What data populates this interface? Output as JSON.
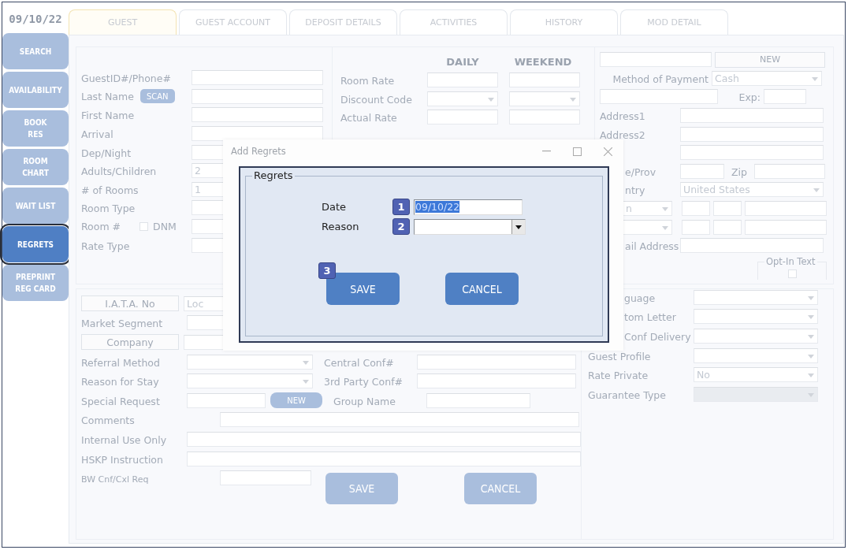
{
  "date": "09/10/22",
  "sidebar": [
    {
      "label": "SEARCH",
      "selected": false
    },
    {
      "label": "AVAILABILITY",
      "selected": false
    },
    {
      "label": "BOOK\nRES",
      "selected": false
    },
    {
      "label": "ROOM\nCHART",
      "selected": false
    },
    {
      "label": "WAIT LIST",
      "selected": false
    },
    {
      "label": "REGRETS",
      "selected": true
    },
    {
      "label": "PREPRINT\nREG CARD",
      "selected": false
    }
  ],
  "tabs": [
    {
      "label": "GUEST",
      "selected": true
    },
    {
      "label": "GUEST ACCOUNT",
      "selected": false
    },
    {
      "label": "DEPOSIT DETAILS",
      "selected": false
    },
    {
      "label": "ACTIVITIES",
      "selected": false
    },
    {
      "label": "HISTORY",
      "selected": false
    },
    {
      "label": "MOD DETAIL",
      "selected": false
    }
  ],
  "guest": {
    "rows": [
      {
        "kind": "text",
        "label": "GuestID#/Phone#"
      },
      {
        "kind": "scan",
        "label": "Last Name",
        "button": "SCAN"
      },
      {
        "kind": "text",
        "label": "First Name"
      },
      {
        "kind": "text",
        "label": "Arrival"
      },
      {
        "kind": "text",
        "label": "Dep/Night"
      },
      {
        "kind": "text",
        "label": "Adults/Children",
        "value": "2"
      },
      {
        "kind": "text",
        "label": "# of Rooms",
        "value": "1"
      },
      {
        "kind": "text",
        "label": "Room Type"
      },
      {
        "kind": "check",
        "label": "Room #",
        "check_label": "DNM",
        "checked": false
      },
      {
        "kind": "text",
        "label": "Rate Type"
      }
    ]
  },
  "rates": {
    "headers": [
      "DAILY",
      "WEEKEND"
    ],
    "rows": [
      {
        "kind": "text",
        "label": "Room Rate"
      },
      {
        "kind": "select",
        "label": "Discount Code"
      },
      {
        "kind": "text",
        "label": "Actual Rate"
      }
    ]
  },
  "payment": {
    "rows": [
      {
        "kind": "new",
        "button": "NEW"
      },
      {
        "kind": "payment",
        "label": "Method of Payment",
        "value": "Cash"
      },
      {
        "kind": "exp",
        "label": "Exp:"
      },
      {
        "kind": "text",
        "label": "Address1"
      },
      {
        "kind": "text",
        "label": "Address2"
      },
      {
        "kind": "text"
      },
      {
        "kind": "zip",
        "label": "e/Prov",
        "label2": "Zip"
      },
      {
        "kind": "select",
        "label": "ntry",
        "value": "United States"
      },
      {
        "kind": "phone",
        "value": "n"
      },
      {
        "kind": "phone"
      },
      {
        "kind": "text",
        "label": "ail Address"
      }
    ],
    "opt_in": {
      "label": "Opt-In Text",
      "checked": false
    }
  },
  "details": {
    "rows": [
      {
        "kind": "labelbutton",
        "label": "I.A.T.A. No",
        "value": "Loc"
      },
      {
        "kind": "text",
        "label": "Market Segment"
      },
      {
        "kind": "labelbutton-select",
        "label": "Company"
      },
      {
        "kind": "select",
        "label": "Referral Method",
        "side": {
          "label": "Central Conf#",
          "kind": "text"
        }
      },
      {
        "kind": "select",
        "label": "Reason for Stay",
        "side": {
          "label": "3rd Party Conf#",
          "kind": "text"
        }
      },
      {
        "kind": "new",
        "label": "Special Request",
        "button": "NEW",
        "side": {
          "label": "Group Name",
          "kind": "short"
        }
      },
      {
        "kind": "wide-indent",
        "label": "Comments"
      },
      {
        "kind": "wide",
        "label": "Internal Use Only"
      },
      {
        "kind": "wide",
        "label": "HSKP Instruction"
      },
      {
        "kind": "small",
        "label": "BW Cnf/Cxl Req"
      }
    ],
    "buttons": [
      "SAVE",
      "CANCEL"
    ]
  },
  "options": {
    "rows": [
      {
        "label": "guage"
      },
      {
        "label": "tom Letter"
      },
      {
        "label": "Conf Delivery"
      },
      {
        "label": "Guest Profile"
      },
      {
        "label": "Rate Private",
        "value": "No"
      },
      {
        "label": "Guarantee Type",
        "disabled": true
      }
    ]
  },
  "dialog": {
    "title": "Add Regrets",
    "group": "Regrets",
    "fields": [
      {
        "kind": "text",
        "label": "Date",
        "value": "09/10/22",
        "step": "1"
      },
      {
        "kind": "select",
        "label": "Reason",
        "step": "2"
      }
    ],
    "buttons": [
      {
        "label": "SAVE",
        "step": "3"
      },
      {
        "label": "CANCEL"
      }
    ]
  }
}
